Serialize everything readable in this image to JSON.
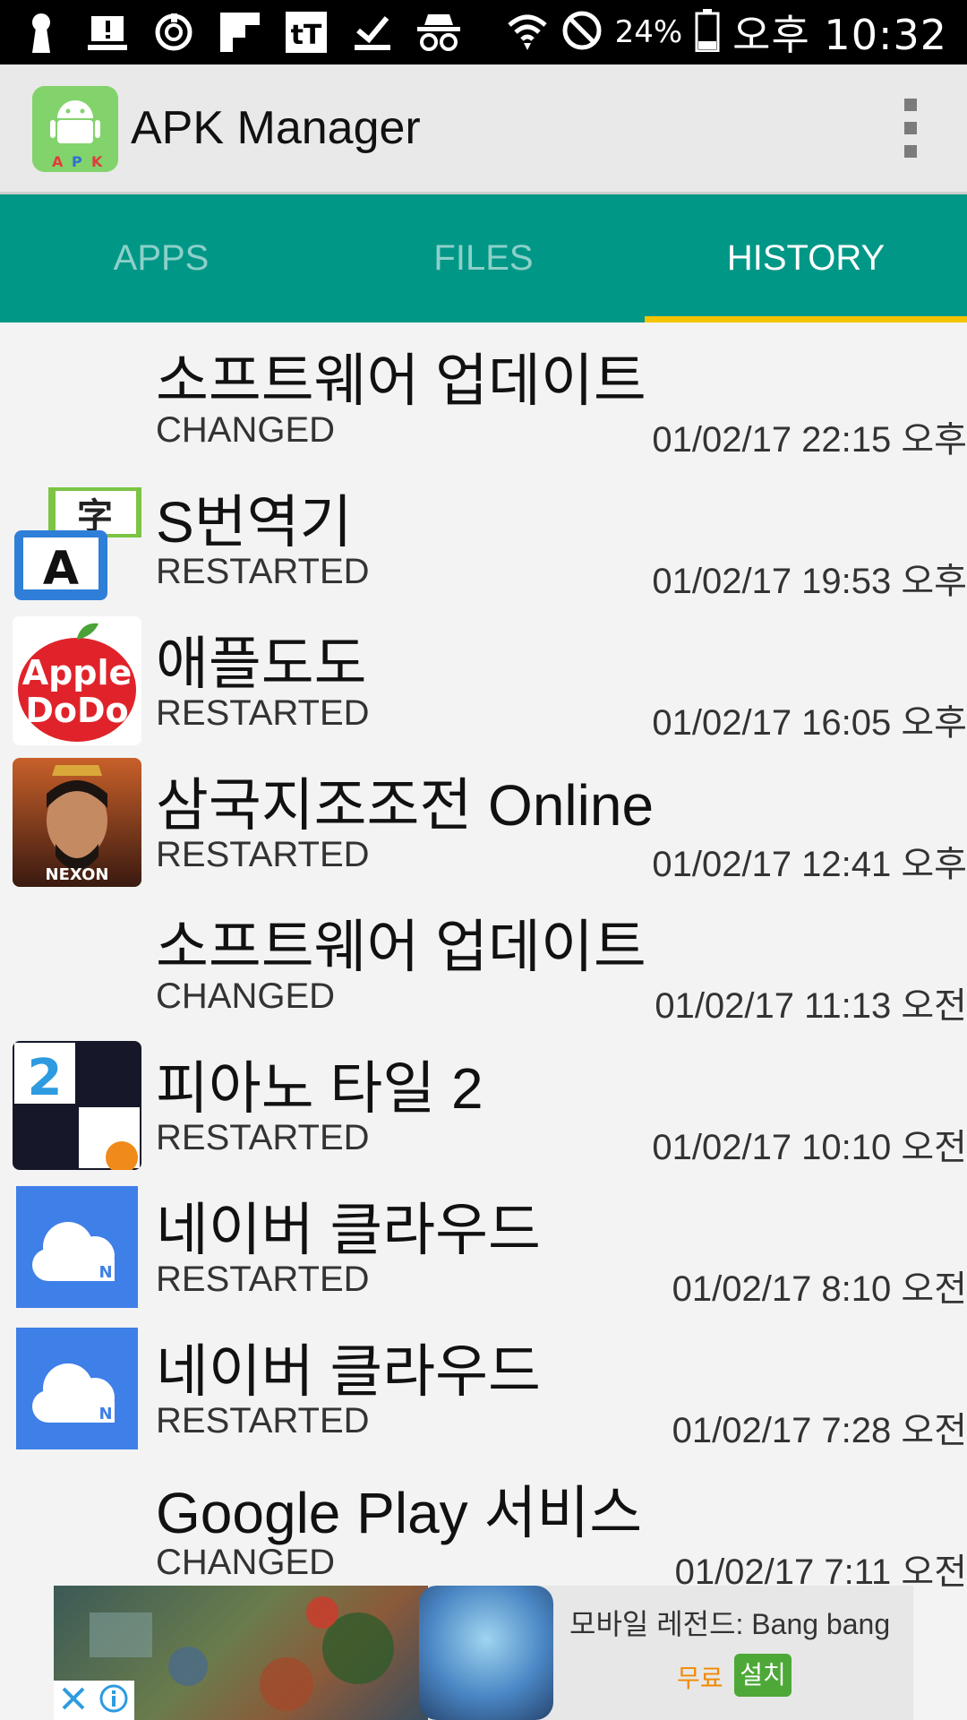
{
  "status_bar": {
    "battery": "24%",
    "time": "오후 10:32",
    "icons": [
      "keyhole-icon",
      "alert-icon",
      "sync-icon",
      "flipboard-icon",
      "tt-icon",
      "download-done-icon",
      "incognito-icon",
      "wifi-icon",
      "no-sign-icon",
      "battery-icon"
    ]
  },
  "app_bar": {
    "title": "APK Manager",
    "logo_letters": [
      "A",
      "P",
      "K"
    ]
  },
  "tabs": [
    {
      "label": "APPS"
    },
    {
      "label": "FILES"
    },
    {
      "label": "HISTORY"
    }
  ],
  "colors": {
    "primary": "#009787",
    "accent": "#f4c400"
  },
  "history": [
    {
      "name": "소프트웨어 업데이트",
      "status": "CHANGED",
      "time": "01/02/17 22:15 오후",
      "icon": "none"
    },
    {
      "name": "S번역기",
      "status": "RESTARTED",
      "time": "01/02/17 19:53 오후",
      "icon": "translate-icon"
    },
    {
      "name": "애플도도",
      "status": "RESTARTED",
      "time": "01/02/17 16:05 오후",
      "icon": "apple-dodo-icon"
    },
    {
      "name": "삼국지조조전 Online",
      "status": "RESTARTED",
      "time": "01/02/17 12:41 오후",
      "icon": "nexon-game-icon"
    },
    {
      "name": "소프트웨어 업데이트",
      "status": "CHANGED",
      "time": "01/02/17 11:13 오전",
      "icon": "none"
    },
    {
      "name": "피아노 타일 2",
      "status": "RESTARTED",
      "time": "01/02/17 10:10 오전",
      "icon": "piano-tiles-icon"
    },
    {
      "name": "네이버 클라우드",
      "status": "RESTARTED",
      "time": "01/02/17 8:10 오전",
      "icon": "naver-cloud-icon"
    },
    {
      "name": "네이버 클라우드",
      "status": "RESTARTED",
      "time": "01/02/17 7:28 오전",
      "icon": "naver-cloud-icon"
    },
    {
      "name": "Google Play 서비스",
      "status": "CHANGED",
      "time": "01/02/17 7:11 오전",
      "icon": "none"
    }
  ],
  "ad": {
    "title": "모바일 레전드: Bang bang",
    "price": "무료",
    "install": "설치"
  }
}
